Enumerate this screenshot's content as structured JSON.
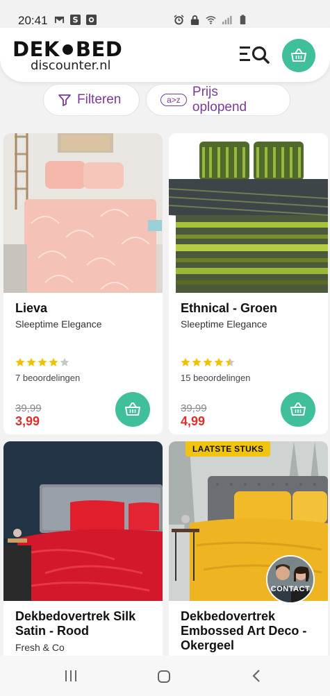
{
  "status_bar": {
    "time": "20:41"
  },
  "header": {
    "logo_top_left": "DEK",
    "logo_top_right": "BED",
    "logo_sub": "discounter.nl"
  },
  "filters": {
    "filter_label": "Filteren",
    "sort_icon_text": "a>z",
    "sort_label": "Prijs oplopend"
  },
  "products": [
    {
      "title": "Lieva",
      "brand": "Sleeptime Elegance",
      "rating": 4,
      "reviews": "7 beoordelingen",
      "old_price": "39,99",
      "price": "3,99"
    },
    {
      "title": "Ethnical - Groen",
      "brand": "Sleeptime Elegance",
      "rating": 4.5,
      "reviews": "15 beoordelingen",
      "old_price": "39,99",
      "price": "4,99"
    },
    {
      "title": "Dekbedovertrek Silk Satin - Rood",
      "brand": "Fresh & Co"
    },
    {
      "title": "Dekbedovertrek Embossed Art Deco - Okergeel",
      "badge": "LAATSTE STUKS"
    }
  ],
  "contact": {
    "label": "CONTACT"
  },
  "colors": {
    "accent": "#3fbf9a",
    "price": "#d9312b",
    "purple": "#7a3a9a",
    "star": "#f2c200"
  }
}
